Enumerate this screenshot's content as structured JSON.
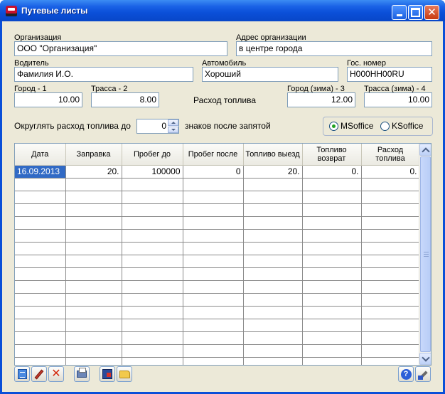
{
  "window": {
    "title": "Путевые листы"
  },
  "header": {
    "organization": {
      "label": "Организация",
      "value": "ООО \"Организация\""
    },
    "org_address": {
      "label": "Адрес организации",
      "value": "в центре города"
    },
    "driver": {
      "label": "Водитель",
      "value": "Фамилия И.О."
    },
    "car": {
      "label": "Автомобиль",
      "value": "Хороший"
    },
    "plate": {
      "label": "Гос. номер",
      "value": "Н000НН00RU"
    }
  },
  "fuel": {
    "title": "Расход топлива",
    "city": {
      "label": "Город - 1",
      "value": "10.00"
    },
    "highway": {
      "label": "Трасса - 2",
      "value": "8.00"
    },
    "city_winter": {
      "label": "Город (зима) - 3",
      "value": "12.00"
    },
    "highway_winter": {
      "label": "Трасса (зима) - 4",
      "value": "10.00"
    }
  },
  "rounding": {
    "label_before": "Округлять расход топлива до",
    "value": "0",
    "label_after": "знаков после запятой"
  },
  "format": {
    "options": [
      "MSoffice",
      "KSoffice"
    ],
    "selected": "MSoffice"
  },
  "table": {
    "columns": [
      "Дата",
      "Заправка",
      "Пробег до",
      "Пробег после",
      "Топливо выезд",
      "Топливо возврат",
      "Расход топлива"
    ],
    "rows": [
      [
        "16.09.2013",
        "20.",
        "100000",
        "0",
        "20.",
        "0.",
        "0."
      ]
    ],
    "empty_row_count": 15
  },
  "toolbar": {
    "buttons": [
      "list-icon",
      "pencil-icon",
      "delete-icon",
      "print-icon",
      "export-icon",
      "folder-icon",
      "help-icon",
      "tools-icon"
    ]
  }
}
